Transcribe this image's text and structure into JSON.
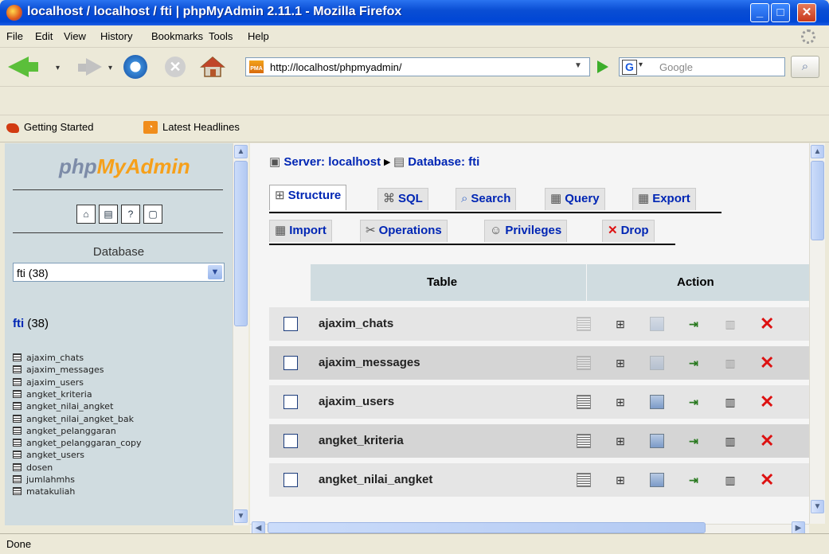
{
  "window": {
    "title": "localhost / localhost / fti | phpMyAdmin 2.11.1 - Mozilla Firefox"
  },
  "menu": [
    "File",
    "Edit",
    "View",
    "History",
    "Bookmarks",
    "Tools",
    "Help"
  ],
  "nav": {
    "url": "http://localhost/phpmyadmin/",
    "search_placeholder": "Google"
  },
  "bookmarks": [
    "Getting Started",
    "Latest Headlines"
  ],
  "left": {
    "logo_main": "php",
    "logo_highlight": "MyAdmin",
    "database_label": "Database",
    "database_select": "fti (38)",
    "db_name": "fti",
    "db_count": " (38)",
    "tables": [
      "ajaxim_chats",
      "ajaxim_messages",
      "ajaxim_users",
      "angket_kriteria",
      "angket_nilai_angket",
      "angket_nilai_angket_bak",
      "angket_pelanggaran",
      "angket_pelanggaran_copy",
      "angket_users",
      "dosen",
      "jumlahmhs",
      "matakuliah"
    ]
  },
  "main": {
    "breadcrumb_server": "Server: localhost",
    "breadcrumb_db": "Database: fti",
    "tabs_row1": [
      "Structure",
      "SQL",
      "Search",
      "Query",
      "Export"
    ],
    "tabs_row2": [
      "Import",
      "Operations",
      "Privileges",
      "Drop"
    ],
    "col_table": "Table",
    "col_action": "Action",
    "rows": [
      "ajaxim_chats",
      "ajaxim_messages",
      "ajaxim_users",
      "angket_kriteria",
      "angket_nilai_angket"
    ]
  },
  "status": "Done"
}
